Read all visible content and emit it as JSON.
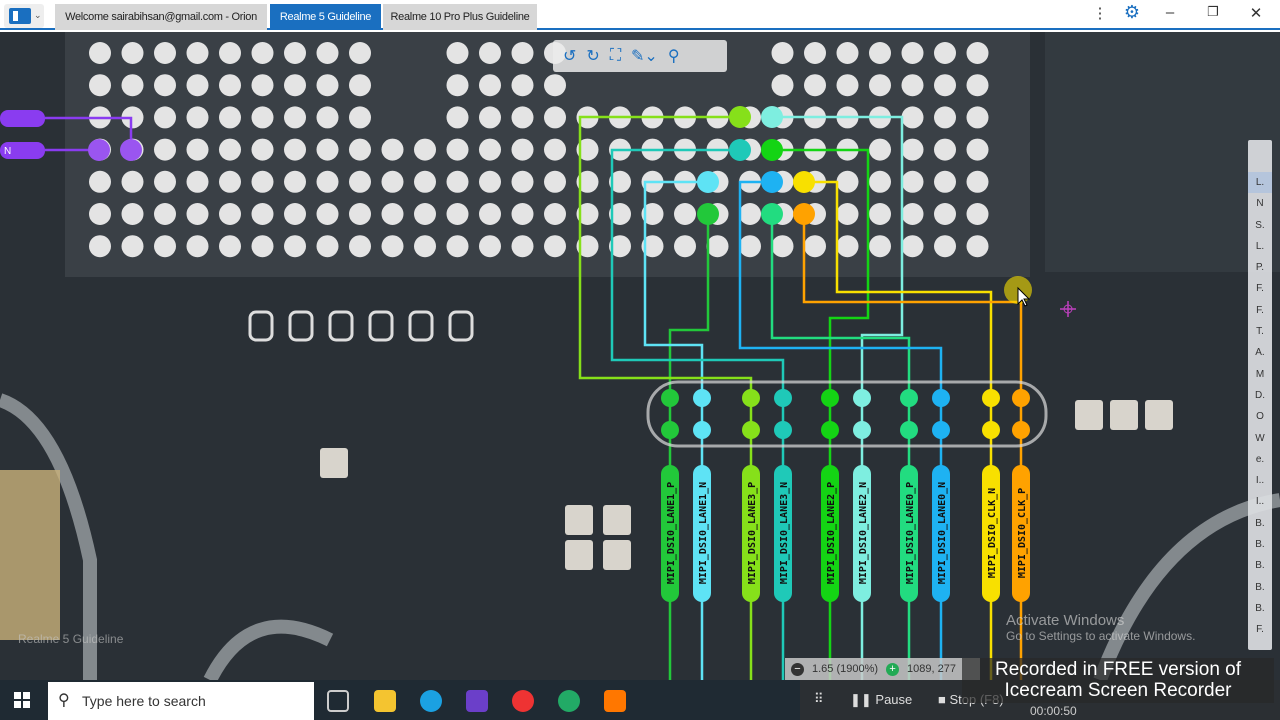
{
  "tabs": [
    {
      "label": "Welcome sairabihsan@gmail.com - Orion",
      "active": false
    },
    {
      "label": "Realme 5 Guideline",
      "active": true
    },
    {
      "label": "Realme 10 Pro Plus Guideline",
      "active": false
    }
  ],
  "window_controls": [
    "more-icon",
    "gear-icon",
    "minimize-icon",
    "restore-icon",
    "close-icon"
  ],
  "toolbar_icons": [
    "rotate-left-icon",
    "rotate-right-icon",
    "fit-screen-icon",
    "brush-icon",
    "search-icon"
  ],
  "signals": [
    {
      "label": "MIPI_DSI0_LANE1_P",
      "color": "#22c83a"
    },
    {
      "label": "MIPI_DSI0_LANE1_N",
      "color": "#5ee3f5"
    },
    {
      "label": "MIPI_DSI0_LANE3_P",
      "color": "#86e01a"
    },
    {
      "label": "MIPI_DSI0_LANE3_N",
      "color": "#1fc9b8"
    },
    {
      "label": "MIPI_DSI0_LANE2_P",
      "color": "#14d414"
    },
    {
      "label": "MIPI_DSI0_LANE2_N",
      "color": "#7eeee0"
    },
    {
      "label": "MIPI_DSI0_LANE0_P",
      "color": "#22dc80"
    },
    {
      "label": "MIPI_DSI0_LANE0_N",
      "color": "#1eb2f2"
    },
    {
      "label": "MIPI_DSI0_CLK_N",
      "color": "#f8e000"
    },
    {
      "label": "MIPI_DSI0_CLK_P",
      "color": "#ffa200"
    }
  ],
  "left_labels": [
    {
      "label": "N",
      "color": "#8a3cf0"
    }
  ],
  "side_index": [
    "L.",
    "N",
    "S.",
    "L.",
    "P.",
    "F.",
    "F.",
    "T.",
    "A.",
    "M",
    "D.",
    "O",
    "W",
    "e.",
    "I..",
    "I..",
    "B.",
    "B.",
    "B.",
    "B.",
    "B.",
    "F."
  ],
  "watermark": "Realme 5 Guideline",
  "activate": {
    "title": "Activate Windows",
    "sub": "Go to Settings to activate Windows."
  },
  "status": {
    "zoom": "1.65 (1900%)",
    "coords": "1089, 277"
  },
  "taskbar": {
    "search_placeholder": "Type here to search"
  },
  "recorder": {
    "pause": "Pause",
    "stop": "Stop (F8)",
    "time": "00:00:50",
    "banner_line1": "Recorded in FREE version of",
    "banner_line2": "Icecream  Screen  Recorder"
  }
}
